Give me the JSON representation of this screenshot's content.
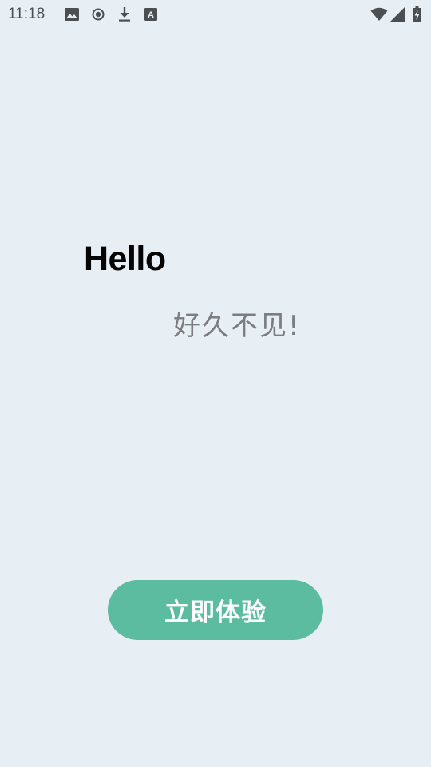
{
  "status_bar": {
    "time": "11:18",
    "left_icons": [
      "image-icon",
      "record-icon",
      "download-icon",
      "keyboard-a-icon"
    ],
    "right_icons": [
      "wifi-icon",
      "cell-signal-icon",
      "battery-charging-icon"
    ]
  },
  "greeting": {
    "title": "Hello",
    "subtitle": "好久不见!"
  },
  "cta": {
    "label": "立即体验",
    "color": "#5cbc9f"
  },
  "colors": {
    "background": "#e8eff4",
    "title": "#050505",
    "subtitle": "#7b7d80",
    "button_text": "#ffffff"
  }
}
